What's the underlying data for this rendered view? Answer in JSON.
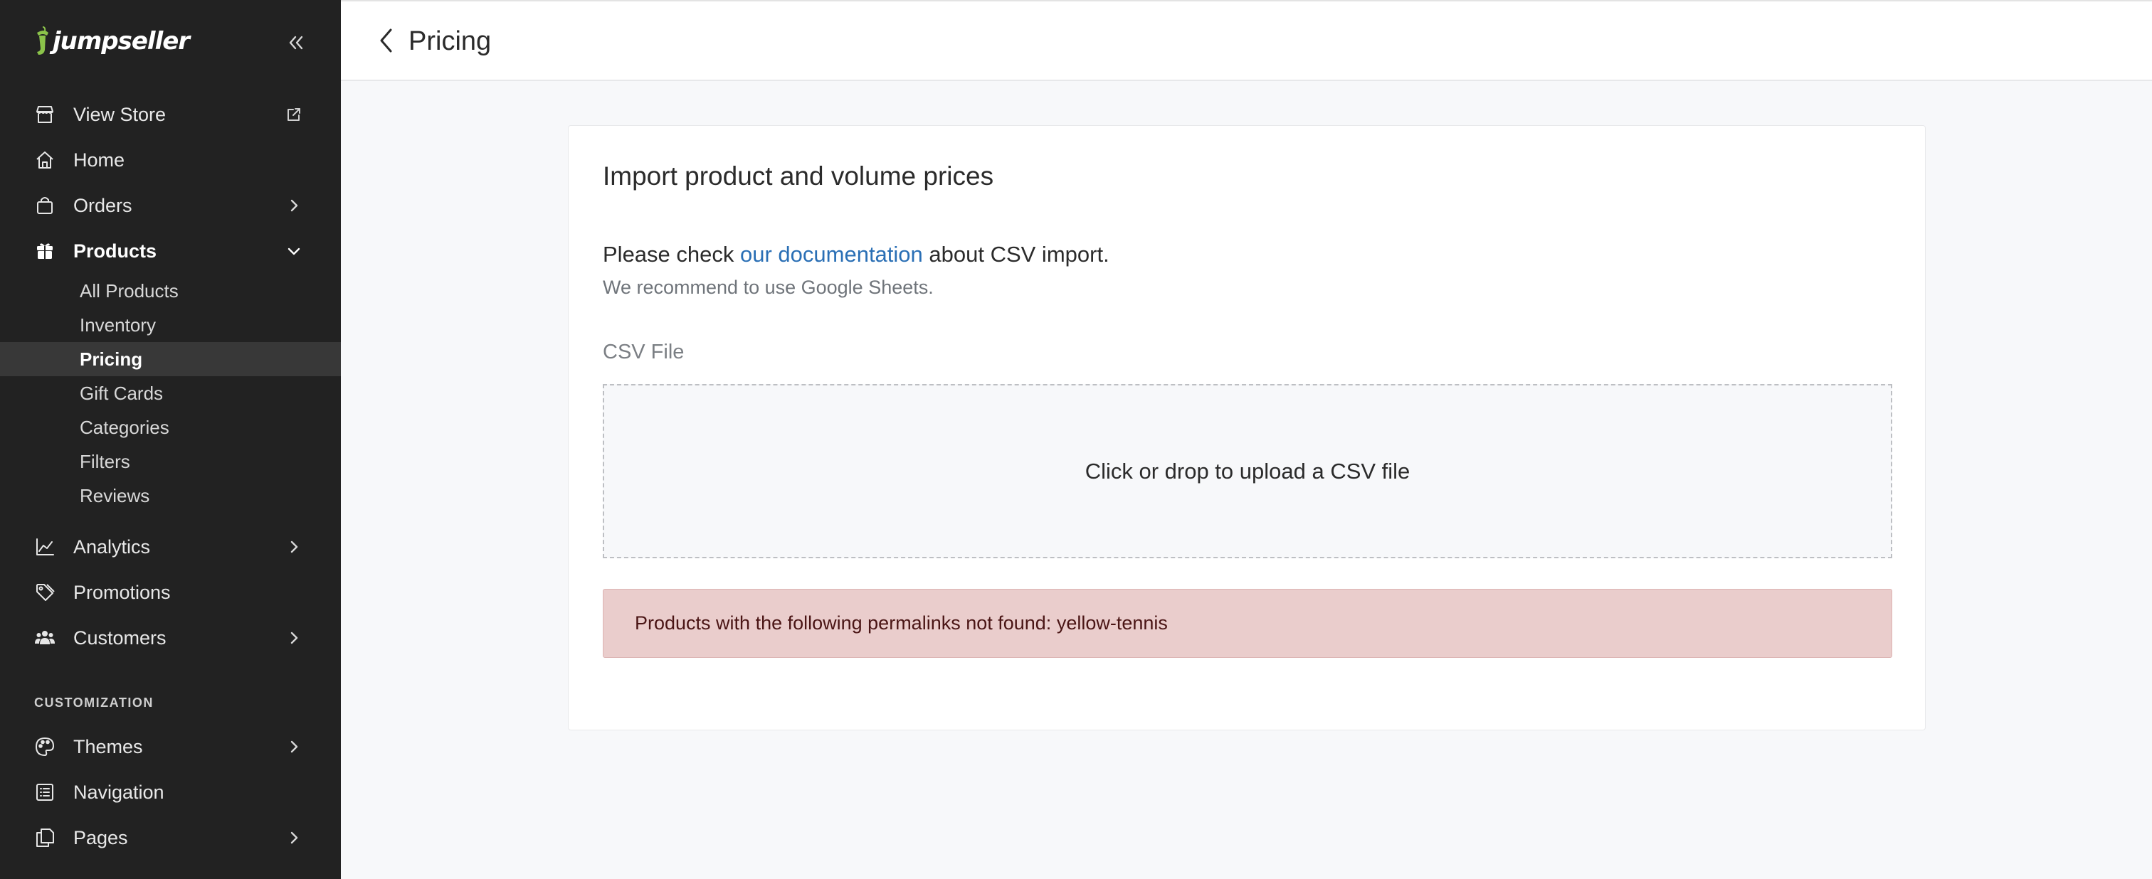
{
  "brand": {
    "name": "jumpseller",
    "accent_color": "#8bc34a"
  },
  "sidebar": {
    "items": [
      {
        "label": "View Store",
        "icon": "store-icon",
        "trailing_icon": "external-link-icon"
      },
      {
        "label": "Home",
        "icon": "home-icon"
      },
      {
        "label": "Orders",
        "icon": "shopping-bag-icon",
        "trailing_icon": "chevron-right-icon"
      },
      {
        "label": "Products",
        "icon": "gift-box-icon",
        "trailing_icon": "chevron-down-icon",
        "active": true
      },
      {
        "label": "Analytics",
        "icon": "line-chart-icon",
        "trailing_icon": "chevron-right-icon"
      },
      {
        "label": "Promotions",
        "icon": "tag-icon",
        "trailing_icon": ""
      },
      {
        "label": "Customers",
        "icon": "users-icon",
        "trailing_icon": "chevron-right-icon"
      },
      {
        "label": "Themes",
        "icon": "palette-icon",
        "trailing_icon": "chevron-right-icon"
      },
      {
        "label": "Navigation",
        "icon": "list-icon",
        "trailing_icon": ""
      },
      {
        "label": "Pages",
        "icon": "pages-icon",
        "trailing_icon": "chevron-right-icon"
      }
    ],
    "products_submenu": [
      {
        "label": "All Products"
      },
      {
        "label": "Inventory"
      },
      {
        "label": "Pricing",
        "selected": true
      },
      {
        "label": "Gift Cards"
      },
      {
        "label": "Categories"
      },
      {
        "label": "Filters"
      },
      {
        "label": "Reviews"
      }
    ],
    "section_customization": "CUSTOMIZATION"
  },
  "header": {
    "title": "Pricing"
  },
  "main": {
    "card_title": "Import product and volume prices",
    "doc_prefix": "Please check ",
    "doc_link": "our documentation",
    "doc_suffix": " about CSV import.",
    "hint": "We recommend to use Google Sheets.",
    "field_label": "CSV File",
    "dropzone_text": "Click or drop to upload a CSV file",
    "error_message": "Products with the following permalinks not found: yellow-tennis"
  },
  "colors": {
    "sidebar_bg": "#222222",
    "link": "#2a6fb5",
    "error_bg": "#eacdcc",
    "error_text": "#4a1515"
  }
}
